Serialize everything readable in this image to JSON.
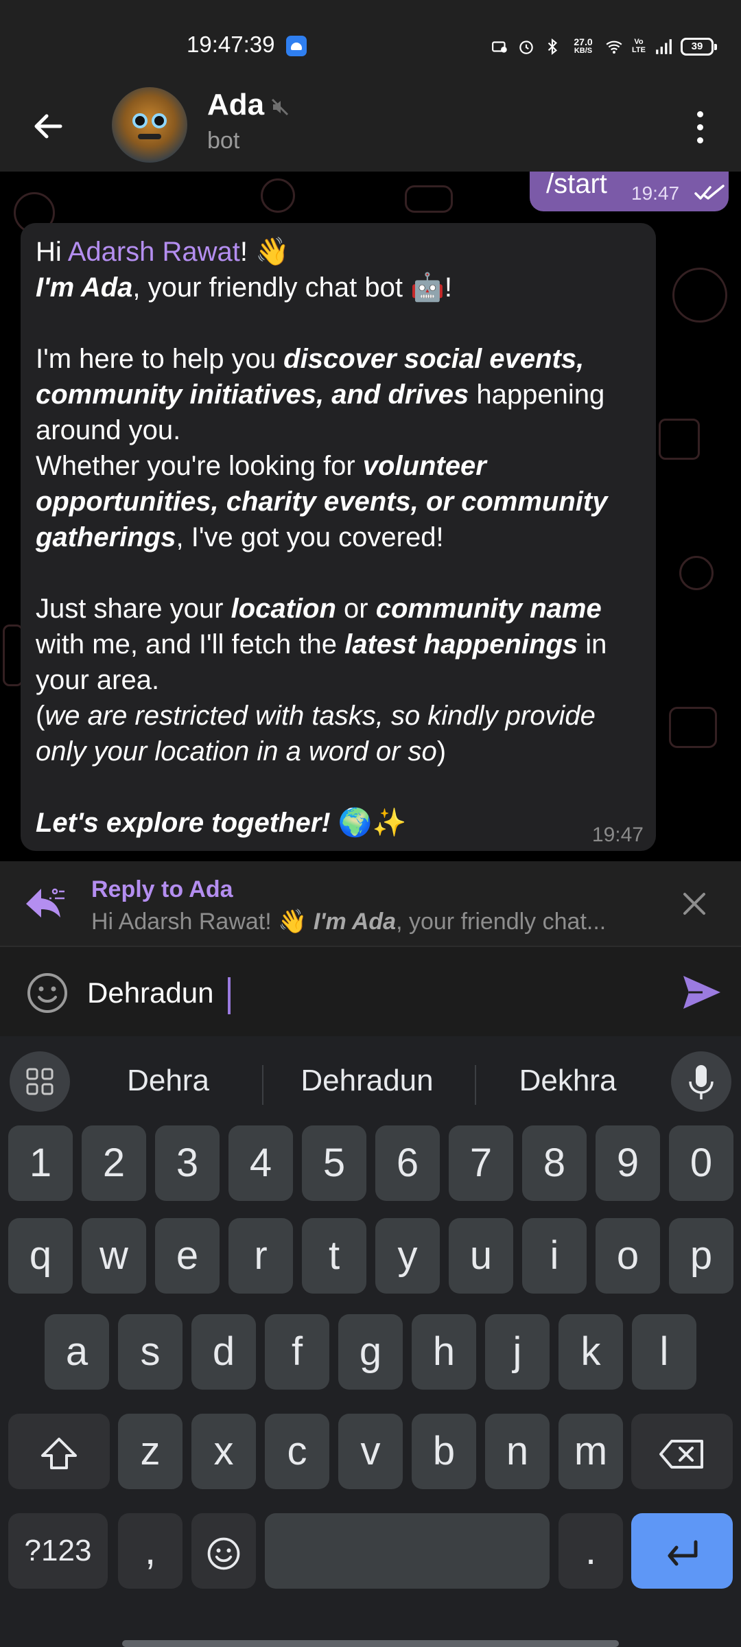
{
  "status_bar": {
    "time": "19:47:39",
    "net_speed_value": "27.0",
    "net_speed_unit": "KB/S",
    "volte": "Vo LTE",
    "battery": "39"
  },
  "header": {
    "name": "Ada",
    "subtitle": "bot"
  },
  "messages": {
    "outgoing": {
      "text": "/start",
      "time": "19:47"
    },
    "incoming": {
      "time": "19:47",
      "greeting_prefix": "Hi ",
      "mention": "Adarsh Rawat",
      "greeting_suffix": "! 👋",
      "intro_bold": "I'm Ada",
      "intro_rest": ", your friendly chat bot 🤖!",
      "help_prefix": "I'm here to help you ",
      "help_bold": "discover social events, community initiatives, and drives",
      "help_suffix": " happening around you.",
      "whether_prefix": "Whether you're looking for ",
      "whether_bold": "volunteer opportunities, charity events, or community gatherings",
      "whether_suffix": ", I've got you covered!",
      "share_prefix": "Just share your ",
      "share_bold1": "location",
      "share_mid1": " or ",
      "share_bold2": "community name",
      "share_mid2": " with me, and I'll fetch the ",
      "share_bold3": "latest happenings",
      "share_suffix": " in your area.",
      "restrict_open": "(",
      "restrict_italic": "we are restricted with tasks, so kindly provide only your location in a word or so",
      "restrict_close": ")",
      "closing_bold": "Let's explore together!",
      "closing_emoji": " 🌍✨"
    }
  },
  "reply": {
    "title": "Reply to Ada",
    "preview_prefix": "Hi Adarsh Rawat! 👋 ",
    "preview_bold": "I'm Ada",
    "preview_suffix": ", your friendly chat..."
  },
  "composer": {
    "value": "Dehradun"
  },
  "keyboard": {
    "suggestions": [
      "Dehra",
      "Dehradun",
      "Dekhra"
    ],
    "number_row": [
      "1",
      "2",
      "3",
      "4",
      "5",
      "6",
      "7",
      "8",
      "9",
      "0"
    ],
    "row1": [
      "q",
      "w",
      "e",
      "r",
      "t",
      "y",
      "u",
      "i",
      "o",
      "p"
    ],
    "row2": [
      "a",
      "s",
      "d",
      "f",
      "g",
      "h",
      "j",
      "k",
      "l"
    ],
    "row3": [
      "z",
      "x",
      "c",
      "v",
      "b",
      "n",
      "m"
    ],
    "symbols_key": "?123",
    "comma_key": ",",
    "period_key": "."
  },
  "colors": {
    "accent": "#b48ef0",
    "outgoing_bubble": "#7b5aa8",
    "enter_key": "#5e97f6"
  }
}
